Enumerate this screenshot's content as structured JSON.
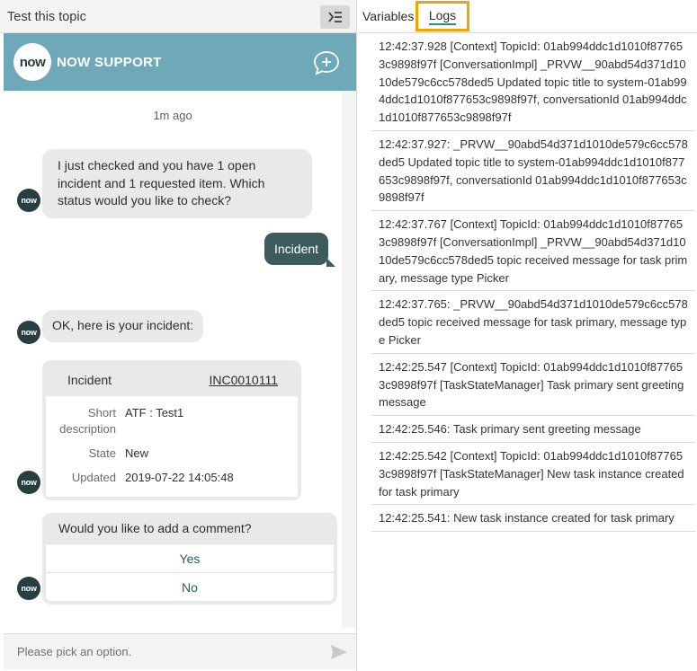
{
  "left_panel": {
    "title": "Test this topic",
    "brand": {
      "logo_text": "now",
      "name": "NOW SUPPORT"
    }
  },
  "chat": {
    "timestamp": "1m ago",
    "avatar_text": "now",
    "bot_message_1": "I just checked and you have 1 open incident and 1 requested item.  Which status would you like to check?",
    "user_message": "Incident",
    "bot_message_2": "OK, here is your incident:",
    "incident_card": {
      "title": "Incident",
      "number": "INC0010111",
      "rows": [
        {
          "label": "Short description",
          "value": "ATF : Test1"
        },
        {
          "label": "State",
          "value": "New"
        },
        {
          "label": "Updated",
          "value": "2019-07-22 14:05:48"
        }
      ]
    },
    "options_prompt": {
      "question": "Would you like to add a comment?",
      "options": [
        "Yes",
        "No"
      ]
    },
    "input_placeholder": "Please pick an option."
  },
  "tabs": {
    "variables": "Variables",
    "logs": "Logs",
    "active": "Logs"
  },
  "logs": [
    "12:42:37.928 [Context] TopicId: 01ab994ddc1d1010f877653c9898f97f [ConversationImpl] _PRVW__90abd54d371d1010de579c6cc578ded5 Updated topic title to system-01ab994ddc1d1010f877653c9898f97f, conversationId 01ab994ddc1d1010f877653c9898f97f",
    "12:42:37.927: _PRVW__90abd54d371d1010de579c6cc578ded5 Updated topic title to system-01ab994ddc1d1010f877653c9898f97f, conversationId 01ab994ddc1d1010f877653c9898f97f",
    "12:42:37.767 [Context] TopicId: 01ab994ddc1d1010f877653c9898f97f [ConversationImpl] _PRVW__90abd54d371d1010de579c6cc578ded5 topic received message for task primary, message type Picker",
    "12:42:37.765: _PRVW__90abd54d371d1010de579c6cc578ded5 topic received message for task primary, message type Picker",
    "12:42:25.547 [Context] TopicId: 01ab994ddc1d1010f877653c9898f97f [TaskStateManager] Task primary sent greeting message",
    "12:42:25.546: Task primary sent greeting message",
    "12:42:25.542 [Context] TopicId: 01ab994ddc1d1010f877653c9898f97f [TaskStateManager] New task instance created for task primary",
    "12:42:25.541: New task instance created for task primary"
  ],
  "colors": {
    "brand_bar": "#6ea8b9",
    "user_bubble": "#3d5a5c",
    "avatar": "#293e41",
    "active_tab_highlight": "#f0a500",
    "option_text": "#2a5a64"
  },
  "icons": {
    "toggle": "sidebar-toggle-icon",
    "new_chat": "chat-plus-icon",
    "send": "send-arrow-icon"
  }
}
